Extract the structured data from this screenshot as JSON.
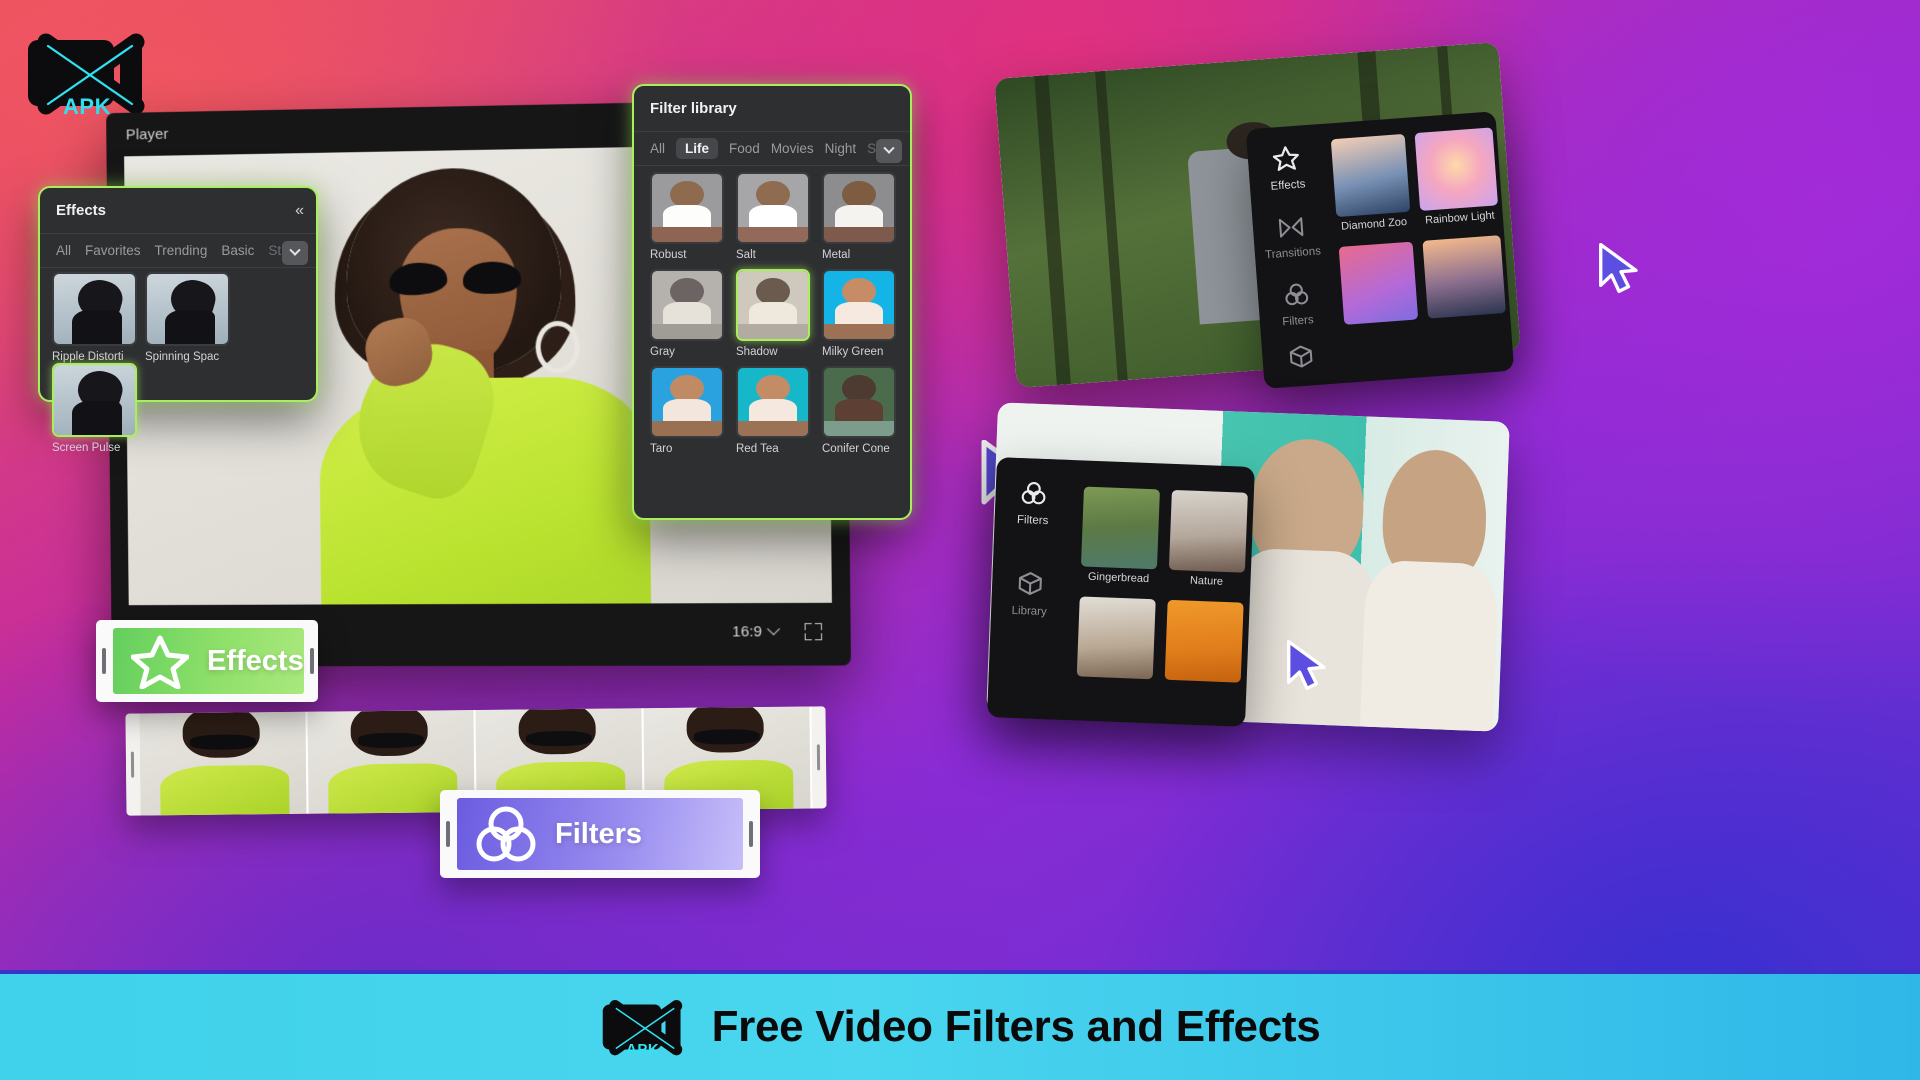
{
  "brand": {
    "logo_text": "APK",
    "logo_icon": "capcut-x-icon"
  },
  "banner": {
    "title": "Free Video Filters and Effects",
    "logo_text": "APK"
  },
  "app_window": {
    "player_label": "Player",
    "aspect_ratio": "16:9",
    "ratio_chevron_icon": "chevron-down-icon",
    "fullscreen_icon": "fullscreen-icon"
  },
  "effects_panel": {
    "title": "Effects",
    "collapse_icon": "collapse-left-icon",
    "collapse_glyph": "«",
    "tabs": [
      {
        "label": "All",
        "active": false
      },
      {
        "label": "Favorites",
        "active": false
      },
      {
        "label": "Trending",
        "active": false
      },
      {
        "label": "Basic",
        "active": false
      },
      {
        "label": "St..",
        "active": false
      }
    ],
    "more_icon": "chevron-down-icon",
    "items": [
      {
        "label": "Ripple Distorti",
        "selected": false
      },
      {
        "label": "Spinning Spac",
        "selected": false
      },
      {
        "label": "Screen Pulse",
        "selected": true
      }
    ]
  },
  "filter_panel": {
    "title": "Filter library",
    "tabs": [
      {
        "label": "All",
        "active": false
      },
      {
        "label": "Life",
        "active": true
      },
      {
        "label": "Food",
        "active": false
      },
      {
        "label": "Movies",
        "active": false
      },
      {
        "label": "Night",
        "active": false
      },
      {
        "label": "S..",
        "active": false
      }
    ],
    "more_icon": "chevron-down-icon",
    "items": [
      {
        "label": "Robust",
        "selected": false
      },
      {
        "label": "Salt",
        "selected": false
      },
      {
        "label": "Metal",
        "selected": false
      },
      {
        "label": "Gray",
        "selected": false
      },
      {
        "label": "Shadow",
        "selected": true
      },
      {
        "label": "Milky Green",
        "selected": false
      },
      {
        "label": "Taro",
        "selected": false
      },
      {
        "label": "Red Tea",
        "selected": false
      },
      {
        "label": "Conifer Cone",
        "selected": false
      }
    ]
  },
  "ribbons": {
    "effects": {
      "label": "Effects",
      "icon": "star-outline-icon",
      "color": "#8fe06a"
    },
    "filters": {
      "label": "Filters",
      "icon": "three-circles-icon",
      "color": "#9b8ff0"
    }
  },
  "mock_top": {
    "rail": [
      {
        "label": "Effects",
        "icon": "star-outline-icon",
        "active": true
      },
      {
        "label": "Transitions",
        "icon": "transitions-bowtie-icon",
        "active": false
      },
      {
        "label": "Filters",
        "icon": "three-circles-icon",
        "active": false
      },
      {
        "label": "",
        "icon": "cube-icon",
        "active": false
      }
    ],
    "items": [
      {
        "label": "Diamond Zoo"
      },
      {
        "label": "Rainbow Light"
      },
      {
        "label": ""
      },
      {
        "label": ""
      }
    ]
  },
  "mock_bottom": {
    "rail": [
      {
        "label": "Filters",
        "icon": "three-circles-icon",
        "active": true
      },
      {
        "label": "Library",
        "icon": "cube-icon",
        "active": false
      }
    ],
    "items": [
      {
        "label": "Gingerbread"
      },
      {
        "label": "Nature"
      },
      {
        "label": ""
      },
      {
        "label": ""
      }
    ]
  },
  "colors": {
    "accent_green": "#a8ef5e",
    "cursor_purple": "#5b4ee0",
    "panel_bg": "#2e2f31",
    "banner_cyan": "#3fd2ea"
  }
}
